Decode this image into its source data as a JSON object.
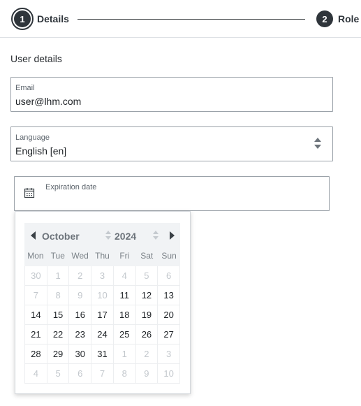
{
  "stepper": {
    "steps": [
      {
        "number": "1",
        "label": "Details",
        "state": "active"
      },
      {
        "number": "2",
        "label": "Role",
        "state": "pending"
      }
    ]
  },
  "form": {
    "section_title": "User details",
    "email": {
      "label": "Email",
      "value": "user@lhm.com"
    },
    "language": {
      "label": "Language",
      "value": "English [en]"
    },
    "expiration": {
      "label": "Expiration date",
      "value": "",
      "icon": "calendar-icon"
    }
  },
  "datepicker": {
    "month": "October",
    "year": "2024",
    "weekdays": [
      "Mon",
      "Tue",
      "Wed",
      "Thu",
      "Fri",
      "Sat",
      "Sun"
    ],
    "weeks": [
      [
        {
          "d": "30",
          "m": true
        },
        {
          "d": "1",
          "m": true
        },
        {
          "d": "2",
          "m": true
        },
        {
          "d": "3",
          "m": true
        },
        {
          "d": "4",
          "m": true
        },
        {
          "d": "5",
          "m": true
        },
        {
          "d": "6",
          "m": true
        }
      ],
      [
        {
          "d": "7",
          "m": true
        },
        {
          "d": "8",
          "m": true
        },
        {
          "d": "9",
          "m": true
        },
        {
          "d": "10",
          "m": true
        },
        {
          "d": "11",
          "m": false
        },
        {
          "d": "12",
          "m": false
        },
        {
          "d": "13",
          "m": false
        }
      ],
      [
        {
          "d": "14",
          "m": false
        },
        {
          "d": "15",
          "m": false
        },
        {
          "d": "16",
          "m": false
        },
        {
          "d": "17",
          "m": false
        },
        {
          "d": "18",
          "m": false
        },
        {
          "d": "19",
          "m": false
        },
        {
          "d": "20",
          "m": false
        }
      ],
      [
        {
          "d": "21",
          "m": false
        },
        {
          "d": "22",
          "m": false
        },
        {
          "d": "23",
          "m": false
        },
        {
          "d": "24",
          "m": false
        },
        {
          "d": "25",
          "m": false
        },
        {
          "d": "26",
          "m": false
        },
        {
          "d": "27",
          "m": false
        }
      ],
      [
        {
          "d": "28",
          "m": false
        },
        {
          "d": "29",
          "m": false
        },
        {
          "d": "30",
          "m": false
        },
        {
          "d": "31",
          "m": false
        },
        {
          "d": "1",
          "m": true
        },
        {
          "d": "2",
          "m": true
        },
        {
          "d": "3",
          "m": true
        }
      ],
      [
        {
          "d": "4",
          "m": true
        },
        {
          "d": "5",
          "m": true
        },
        {
          "d": "6",
          "m": true
        },
        {
          "d": "7",
          "m": true
        },
        {
          "d": "8",
          "m": true
        },
        {
          "d": "9",
          "m": true
        },
        {
          "d": "10",
          "m": true
        }
      ]
    ]
  },
  "colors": {
    "accent": "#2f353b",
    "muted_day": "#c3c8cd",
    "header_bg": "#f1f3f5"
  }
}
